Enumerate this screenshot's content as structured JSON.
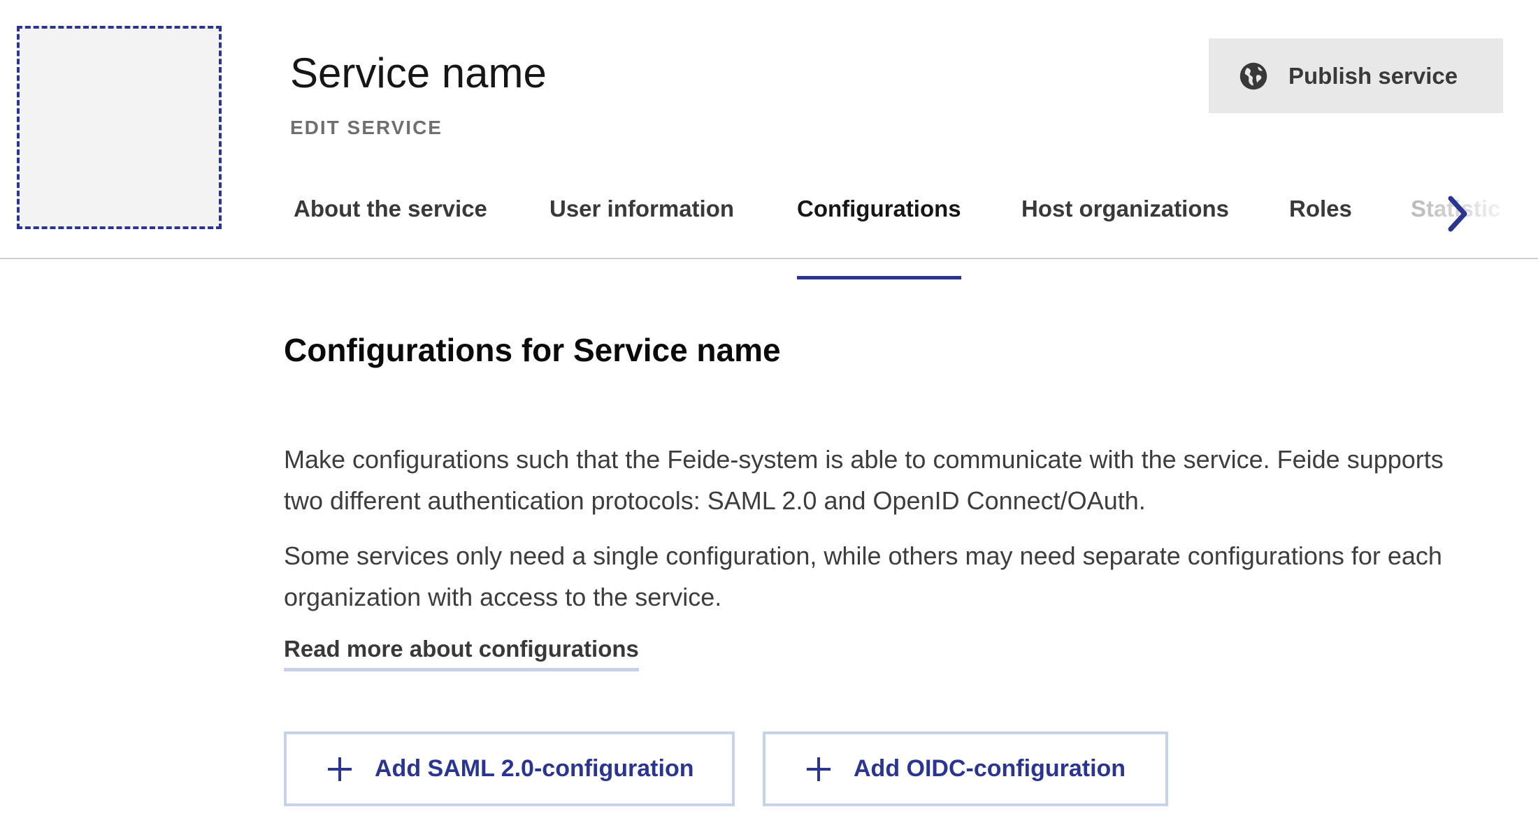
{
  "header": {
    "title": "Service name",
    "subtitle": "EDIT SERVICE",
    "logo_icon": "logo-placeholder",
    "publish_button": {
      "label": "Publish service",
      "icon": "globe-icon"
    }
  },
  "tabs": {
    "items": [
      {
        "label": "About the service",
        "active": false
      },
      {
        "label": "User information",
        "active": false
      },
      {
        "label": "Configurations",
        "active": true
      },
      {
        "label": "Host organizations",
        "active": false
      },
      {
        "label": "Roles",
        "active": false
      },
      {
        "label": "Statistic",
        "active": false
      }
    ],
    "scroll_icon": "chevron-right-icon"
  },
  "main": {
    "title": "Configurations for Service name",
    "paragraphs": [
      "Make configurations such that the Feide-system is able to communicate with the service. Feide supports two different authentication protocols: SAML 2.0 and OpenID Connect/OAuth.",
      "Some services only need a single configuration, while others may need separate configurations for each organization with access to the service."
    ],
    "read_more_link": "Read more about configurations",
    "buttons": {
      "add_saml": {
        "label": "Add SAML 2.0-configuration",
        "icon": "plus-icon"
      },
      "add_oidc": {
        "label": "Add OIDC-configuration",
        "icon": "plus-icon"
      }
    }
  },
  "colors": {
    "accent": "#2a3591",
    "button_border": "#c6d2ea",
    "publish_bg": "#e8e8e8",
    "placeholder_bg": "#f3f3f3"
  }
}
